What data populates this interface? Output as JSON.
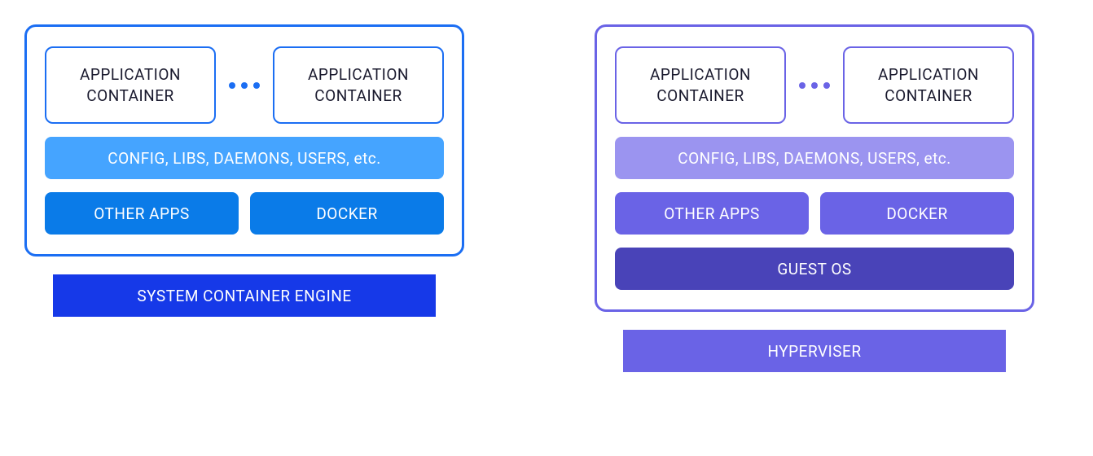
{
  "left": {
    "app_container_1": "APPLICATION\nCONTAINER",
    "app_container_2": "APPLICATION\nCONTAINER",
    "config_row": "CONFIG, LIBS, DAEMONS, USERS, etc.",
    "other_apps": "OTHER APPS",
    "docker": "DOCKER",
    "base": "SYSTEM CONTAINER ENGINE"
  },
  "right": {
    "app_container_1": "APPLICATION\nCONTAINER",
    "app_container_2": "APPLICATION\nCONTAINER",
    "config_row": "CONFIG, LIBS, DAEMONS, USERS, etc.",
    "other_apps": "OTHER APPS",
    "docker": "DOCKER",
    "guest_os": "GUEST OS",
    "base": "HYPERVISER"
  },
  "colors": {
    "blue_border": "#1b6ef3",
    "blue_light": "#45a4ff",
    "blue_mid": "#0a7be8",
    "blue_dark": "#1639e8",
    "purple_border": "#6a63e6",
    "purple_light": "#9b94f0",
    "purple_mid": "#6a63e6",
    "purple_dark": "#4943b8"
  }
}
